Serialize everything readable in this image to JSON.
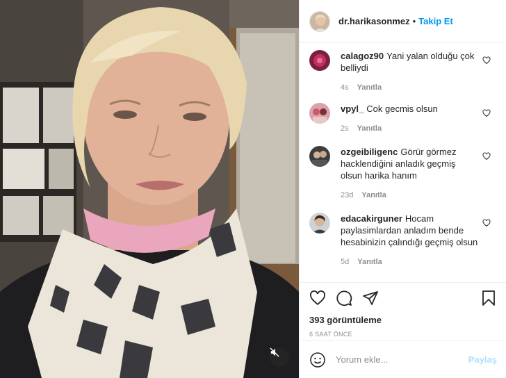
{
  "post": {
    "username": "dr.harikasonmez",
    "separator": "•",
    "follow_label": "Takip Et"
  },
  "comments": [
    {
      "username": "calagoz90",
      "text": "Yani yalan olduğu çok belliydi",
      "age": "4s",
      "reply": "Yanıtla"
    },
    {
      "username": "vpyl_",
      "text": "Cok gecmis olsun",
      "age": "2s",
      "reply": "Yanıtla"
    },
    {
      "username": "ozgeibiligenc",
      "text": "Görür görmez hacklendiğini anladık geçmiş olsun harika hanım",
      "age": "23d",
      "reply": "Yanıtla"
    },
    {
      "username": "edacakirguner",
      "text": "Hocam paylasimlardan anladım bende hesabinizin çalındığı geçmiş olsun",
      "age": "5d",
      "reply": "Yanıtla"
    }
  ],
  "stats": {
    "views": "393 görüntüleme",
    "time_ago": "6 SAAT ÖNCE"
  },
  "composer": {
    "placeholder": "Yorum ekle...",
    "post_label": "Paylaş"
  },
  "icons": {
    "like": "heart-icon",
    "comment": "comment-icon",
    "share": "paper-plane-icon",
    "save": "bookmark-icon",
    "emoji": "smiley-icon",
    "mute": "speaker-muted-icon"
  },
  "colors": {
    "accent": "#0095f6",
    "post_disabled": "#b2dffc",
    "muted_text": "#8e8e8e"
  }
}
